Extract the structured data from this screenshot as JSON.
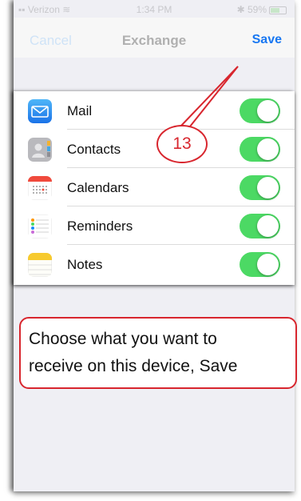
{
  "status_bar": {
    "carrier": "Verizon",
    "time": "1:34 PM",
    "battery": "59%"
  },
  "navbar": {
    "cancel": "Cancel",
    "title": "Exchange",
    "save": "Save"
  },
  "accounts": [
    {
      "label": "Mail",
      "icon": "mail-icon",
      "enabled": true
    },
    {
      "label": "Contacts",
      "icon": "contacts-icon",
      "enabled": true
    },
    {
      "label": "Calendars",
      "icon": "calendar-icon",
      "enabled": true
    },
    {
      "label": "Reminders",
      "icon": "reminders-icon",
      "enabled": true
    },
    {
      "label": "Notes",
      "icon": "notes-icon",
      "enabled": true
    }
  ],
  "callout": {
    "step": "13"
  },
  "instruction": {
    "line1": "Choose what you want to",
    "line2": "receive on this device, Save"
  },
  "colors": {
    "toggle_on": "#4cd964",
    "save": "#1877f2",
    "callout": "#d8262e"
  }
}
